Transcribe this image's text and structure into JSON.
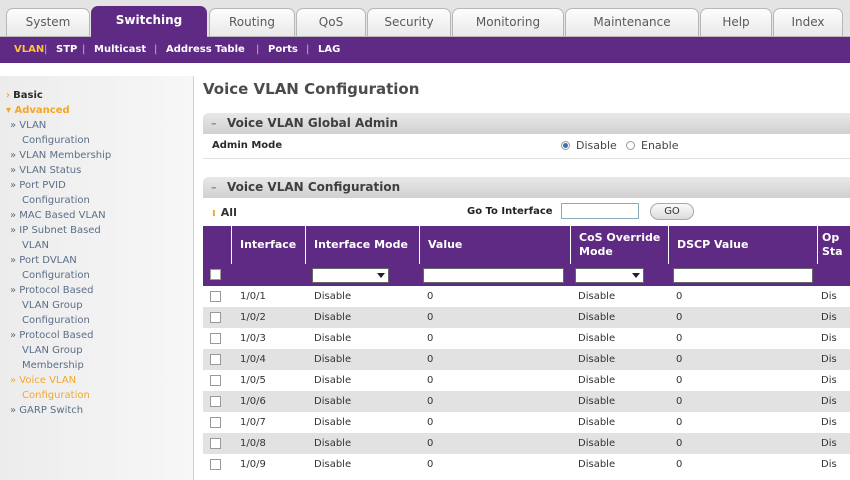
{
  "tabs": [
    {
      "label": "System",
      "active": false
    },
    {
      "label": "Switching",
      "active": true
    },
    {
      "label": "Routing",
      "active": false
    },
    {
      "label": "QoS",
      "active": false
    },
    {
      "label": "Security",
      "active": false
    },
    {
      "label": "Monitoring",
      "active": false
    },
    {
      "label": "Maintenance",
      "active": false
    },
    {
      "label": "Help",
      "active": false
    },
    {
      "label": "Index",
      "active": false
    }
  ],
  "subnav": [
    "VLAN",
    "STP",
    "Multicast",
    "Address Table",
    "Ports",
    "LAG"
  ],
  "sidebar": {
    "basic": "Basic",
    "advanced": "Advanced",
    "items": [
      [
        "» VLAN",
        "Configuration"
      ],
      [
        "» VLAN Membership"
      ],
      [
        "» VLAN Status"
      ],
      [
        "» Port PVID",
        "Configuration"
      ],
      [
        "» MAC Based VLAN"
      ],
      [
        "» IP Subnet Based",
        "VLAN"
      ],
      [
        "» Port DVLAN",
        "Configuration"
      ],
      [
        "» Protocol Based",
        "VLAN Group",
        "Configuration"
      ],
      [
        "» Protocol Based",
        "VLAN Group",
        "Membership"
      ],
      [
        "» Voice VLAN",
        "Configuration"
      ],
      [
        "» GARP Switch"
      ]
    ]
  },
  "page_title": "Voice VLAN Configuration",
  "global_admin": {
    "title": "Voice VLAN Global Admin",
    "label": "Admin Mode",
    "option_disable": "Disable",
    "option_enable": "Enable",
    "selected": "Disable"
  },
  "config": {
    "title": "Voice VLAN Configuration",
    "all_label": "All",
    "goto_label": "Go To Interface",
    "go_button": "GO"
  },
  "table": {
    "headers": {
      "interface": "Interface",
      "mode": "Interface Mode",
      "value": "Value",
      "cos": "CoS Override Mode",
      "dscp": "DSCP Value",
      "oper": "Op Sta"
    },
    "rows": [
      {
        "interface": "1/0/1",
        "mode": "Disable",
        "value": "0",
        "cos": "Disable",
        "dscp": "0",
        "oper": "Dis"
      },
      {
        "interface": "1/0/2",
        "mode": "Disable",
        "value": "0",
        "cos": "Disable",
        "dscp": "0",
        "oper": "Dis"
      },
      {
        "interface": "1/0/3",
        "mode": "Disable",
        "value": "0",
        "cos": "Disable",
        "dscp": "0",
        "oper": "Dis"
      },
      {
        "interface": "1/0/4",
        "mode": "Disable",
        "value": "0",
        "cos": "Disable",
        "dscp": "0",
        "oper": "Dis"
      },
      {
        "interface": "1/0/5",
        "mode": "Disable",
        "value": "0",
        "cos": "Disable",
        "dscp": "0",
        "oper": "Dis"
      },
      {
        "interface": "1/0/6",
        "mode": "Disable",
        "value": "0",
        "cos": "Disable",
        "dscp": "0",
        "oper": "Dis"
      },
      {
        "interface": "1/0/7",
        "mode": "Disable",
        "value": "0",
        "cos": "Disable",
        "dscp": "0",
        "oper": "Dis"
      },
      {
        "interface": "1/0/8",
        "mode": "Disable",
        "value": "0",
        "cos": "Disable",
        "dscp": "0",
        "oper": "Dis"
      },
      {
        "interface": "1/0/9",
        "mode": "Disable",
        "value": "0",
        "cos": "Disable",
        "dscp": "0",
        "oper": "Dis"
      }
    ]
  },
  "colors": {
    "accent": "#5e2a83",
    "highlight": "#f0a830",
    "row_alt": "#e2e2e2"
  }
}
